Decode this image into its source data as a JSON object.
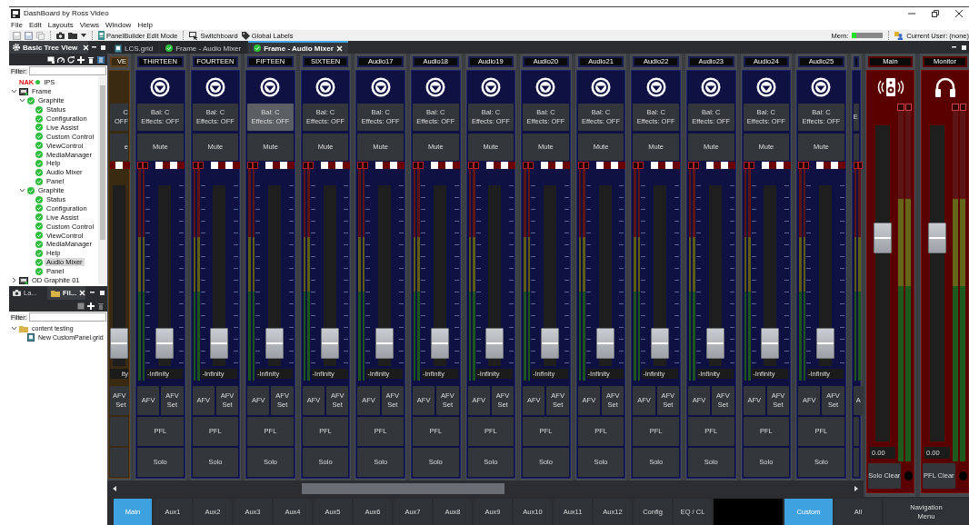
{
  "window": {
    "title": "DashBoard by Ross Video"
  },
  "menu": [
    "File",
    "Edit",
    "Layouts",
    "Views",
    "Window",
    "Help"
  ],
  "toolbar": {
    "buttons": [
      {
        "label": "PanelBuilder Edit Mode",
        "kind": "panelbuilder"
      },
      {
        "label": "Switchboard",
        "kind": "switchboard"
      },
      {
        "label": "Global Labels",
        "kind": "labels"
      }
    ],
    "memory": {
      "label": "Mem:",
      "level": 0.15
    },
    "user": "Current User: (none)"
  },
  "tree_view": {
    "tab": "Basic Tree View",
    "filter_label": "Filter:",
    "items": [
      {
        "label": "IPS",
        "kind": "error",
        "badge": "NAK",
        "selected": false
      },
      {
        "label": "Frame",
        "kind": "frame",
        "expanded": true,
        "selected": false,
        "children": [
          {
            "label": "Graphite",
            "kind": "ok",
            "expanded": true,
            "selected": false,
            "children": [
              {
                "label": "Status",
                "kind": "ok",
                "selected": false
              },
              {
                "label": "Configuration",
                "kind": "ok",
                "selected": false
              },
              {
                "label": "Live Assist",
                "kind": "ok",
                "selected": false
              },
              {
                "label": "Custom Control",
                "kind": "ok",
                "selected": false
              },
              {
                "label": "ViewControl",
                "kind": "ok",
                "selected": false
              },
              {
                "label": "MediaManager",
                "kind": "ok",
                "selected": false
              },
              {
                "label": "Help",
                "kind": "ok",
                "selected": false
              },
              {
                "label": "Audio Mixer",
                "kind": "ok",
                "selected": false
              },
              {
                "label": "Panel",
                "kind": "ok",
                "selected": false
              }
            ]
          },
          {
            "label": "Graphite",
            "kind": "ok",
            "expanded": true,
            "selected": false,
            "children": [
              {
                "label": "Status",
                "kind": "ok",
                "selected": false
              },
              {
                "label": "Configuration",
                "kind": "ok",
                "selected": false
              },
              {
                "label": "Live Assist",
                "kind": "ok",
                "selected": false
              },
              {
                "label": "Custom Control",
                "kind": "ok",
                "selected": false
              },
              {
                "label": "ViewControl",
                "kind": "ok",
                "selected": false
              },
              {
                "label": "MediaManager",
                "kind": "ok",
                "selected": false
              },
              {
                "label": "Help",
                "kind": "ok",
                "selected": false
              },
              {
                "label": "Audio Mixer",
                "kind": "ok",
                "selected": true
              },
              {
                "label": "Panel",
                "kind": "ok",
                "selected": false
              }
            ]
          }
        ]
      },
      {
        "label": "OD Graphite 01",
        "kind": "frame",
        "expanded": false,
        "selected": false
      }
    ]
  },
  "file_view": {
    "tabs": [
      {
        "label": "La...",
        "kind": "camera",
        "selected": false
      },
      {
        "label": "Fil...",
        "kind": "folder",
        "selected": true
      }
    ],
    "filter_label": "Filter:",
    "items": [
      {
        "label": "content testing",
        "kind": "folder",
        "expanded": true,
        "selected": false,
        "children": [
          {
            "label": "New CustomPanel.grid",
            "kind": "grid",
            "selected": false
          }
        ]
      }
    ]
  },
  "editor_tabs": [
    {
      "label": "LCS.grid",
      "kind": "grid",
      "selected": false
    },
    {
      "label": "Frame - Audio Mixer",
      "kind": "ok",
      "selected": false
    },
    {
      "label": "Frame - Audio Mixer",
      "kind": "ok",
      "selected": true
    }
  ],
  "channels": [
    {
      "kind": "cut_left",
      "name": "VE",
      "balance": "C",
      "effects": "OFF",
      "mute": "e",
      "value": "ity",
      "afv_set": "AFV Set",
      "level": 0.05
    },
    {
      "kind": "full",
      "name": "THIRTEEN",
      "balance": "Bal: C",
      "effects": "Effects: OFF",
      "hovered": false,
      "mute": "Mute",
      "value": "-Infinity",
      "afv": "AFV",
      "afv_set": "AFV Set",
      "pfl": "PFL",
      "solo": "Solo",
      "level": 0.05
    },
    {
      "kind": "full",
      "name": "FOURTEEN",
      "balance": "Bal: C",
      "effects": "Effects: OFF",
      "hovered": false,
      "mute": "Mute",
      "value": "-Infinity",
      "afv": "AFV",
      "afv_set": "AFV Set",
      "pfl": "PFL",
      "solo": "Solo",
      "level": 0.05
    },
    {
      "kind": "full",
      "name": "FIFTEEN",
      "balance": "Bal: C",
      "effects": "Effects: OFF",
      "hovered": true,
      "mute": "Mute",
      "value": "-Infinity",
      "afv": "AFV",
      "afv_set": "AFV Set",
      "pfl": "PFL",
      "solo": "Solo",
      "level": 0.05
    },
    {
      "kind": "full",
      "name": "SIXTEEN",
      "balance": "Bal: C",
      "effects": "Effects: OFF",
      "hovered": false,
      "mute": "Mute",
      "value": "-Infinity",
      "afv": "AFV",
      "afv_set": "AFV Set",
      "pfl": "PFL",
      "solo": "Solo",
      "level": 0.05
    },
    {
      "kind": "full",
      "name": "Audio17",
      "balance": "Bal: C",
      "effects": "Effects: OFF",
      "hovered": false,
      "mute": "Mute",
      "value": "-Infinity",
      "afv": "AFV",
      "afv_set": "AFV Set",
      "pfl": "PFL",
      "solo": "Solo",
      "level": 0.05
    },
    {
      "kind": "full",
      "name": "Audio18",
      "balance": "Bal: C",
      "effects": "Effects: OFF",
      "hovered": false,
      "mute": "Mute",
      "value": "-Infinity",
      "afv": "AFV",
      "afv_set": "AFV Set",
      "pfl": "PFL",
      "solo": "Solo",
      "level": 0.05
    },
    {
      "kind": "full",
      "name": "Audio19",
      "balance": "Bal: C",
      "effects": "Effects: OFF",
      "hovered": false,
      "mute": "Mute",
      "value": "-Infinity",
      "afv": "AFV",
      "afv_set": "AFV Set",
      "pfl": "PFL",
      "solo": "Solo",
      "level": 0.05
    },
    {
      "kind": "full",
      "name": "Audio20",
      "balance": "Bal: C",
      "effects": "Effects: OFF",
      "hovered": false,
      "mute": "Mute",
      "value": "-Infinity",
      "afv": "AFV",
      "afv_set": "AFV Set",
      "pfl": "PFL",
      "solo": "Solo",
      "level": 0.05
    },
    {
      "kind": "full",
      "name": "Audio21",
      "balance": "Bal: C",
      "effects": "Effects: OFF",
      "hovered": false,
      "mute": "Mute",
      "value": "-Infinity",
      "afv": "AFV",
      "afv_set": "AFV Set",
      "pfl": "PFL",
      "solo": "Solo",
      "level": 0.05
    },
    {
      "kind": "full",
      "name": "Audio22",
      "balance": "Bal: C",
      "effects": "Effects: OFF",
      "hovered": false,
      "mute": "Mute",
      "value": "-Infinity",
      "afv": "AFV",
      "afv_set": "AFV Set",
      "pfl": "PFL",
      "solo": "Solo",
      "level": 0.05
    },
    {
      "kind": "full",
      "name": "Audio23",
      "balance": "Bal: C",
      "effects": "Effects: OFF",
      "hovered": false,
      "mute": "Mute",
      "value": "-Infinity",
      "afv": "AFV",
      "afv_set": "AFV Set",
      "pfl": "PFL",
      "solo": "Solo",
      "level": 0.05
    },
    {
      "kind": "full",
      "name": "Audio24",
      "balance": "Bal: C",
      "effects": "Effects: OFF",
      "hovered": false,
      "mute": "Mute",
      "value": "-Infinity",
      "afv": "AFV",
      "afv_set": "AFV Set",
      "pfl": "PFL",
      "solo": "Solo",
      "level": 0.05
    },
    {
      "kind": "full",
      "name": "Audio25",
      "balance": "Bal: C",
      "effects": "Effects: OFF",
      "hovered": false,
      "mute": "Mute",
      "value": "-Infinity",
      "afv": "AFV",
      "afv_set": "AFV Set",
      "pfl": "PFL",
      "solo": "Solo",
      "level": 0.05
    },
    {
      "kind": "cut_right",
      "balance": "E",
      "afv": "A"
    }
  ],
  "masters": [
    {
      "name": "Main",
      "kind": "speaker",
      "value": "0.00",
      "button": "Solo Clear",
      "level": 0.66
    },
    {
      "name": "Monitor",
      "kind": "headphones",
      "value": "0.00",
      "button": "PFL Clear",
      "level": 0.66
    }
  ],
  "bus_tabs": [
    {
      "label": "Main",
      "selected": true
    },
    {
      "label": "Aux1",
      "selected": false
    },
    {
      "label": "Aux2",
      "selected": false
    },
    {
      "label": "Aux3",
      "selected": false
    },
    {
      "label": "Aux4",
      "selected": false
    },
    {
      "label": "Aux5",
      "selected": false
    },
    {
      "label": "Aux6",
      "selected": false
    },
    {
      "label": "Aux7",
      "selected": false
    },
    {
      "label": "Aux8",
      "selected": false
    },
    {
      "label": "Aux9",
      "selected": false
    },
    {
      "label": "Aux10",
      "selected": false
    },
    {
      "label": "Aux11",
      "selected": false
    },
    {
      "label": "Aux12",
      "selected": false
    },
    {
      "label": "Config",
      "selected": false
    },
    {
      "label": "EQ / CL",
      "selected": false
    }
  ],
  "view_tabs": [
    {
      "label": "Custom",
      "selected": true
    },
    {
      "label": "All",
      "selected": false
    },
    {
      "label": "Navigation Menu",
      "selected": false
    }
  ]
}
